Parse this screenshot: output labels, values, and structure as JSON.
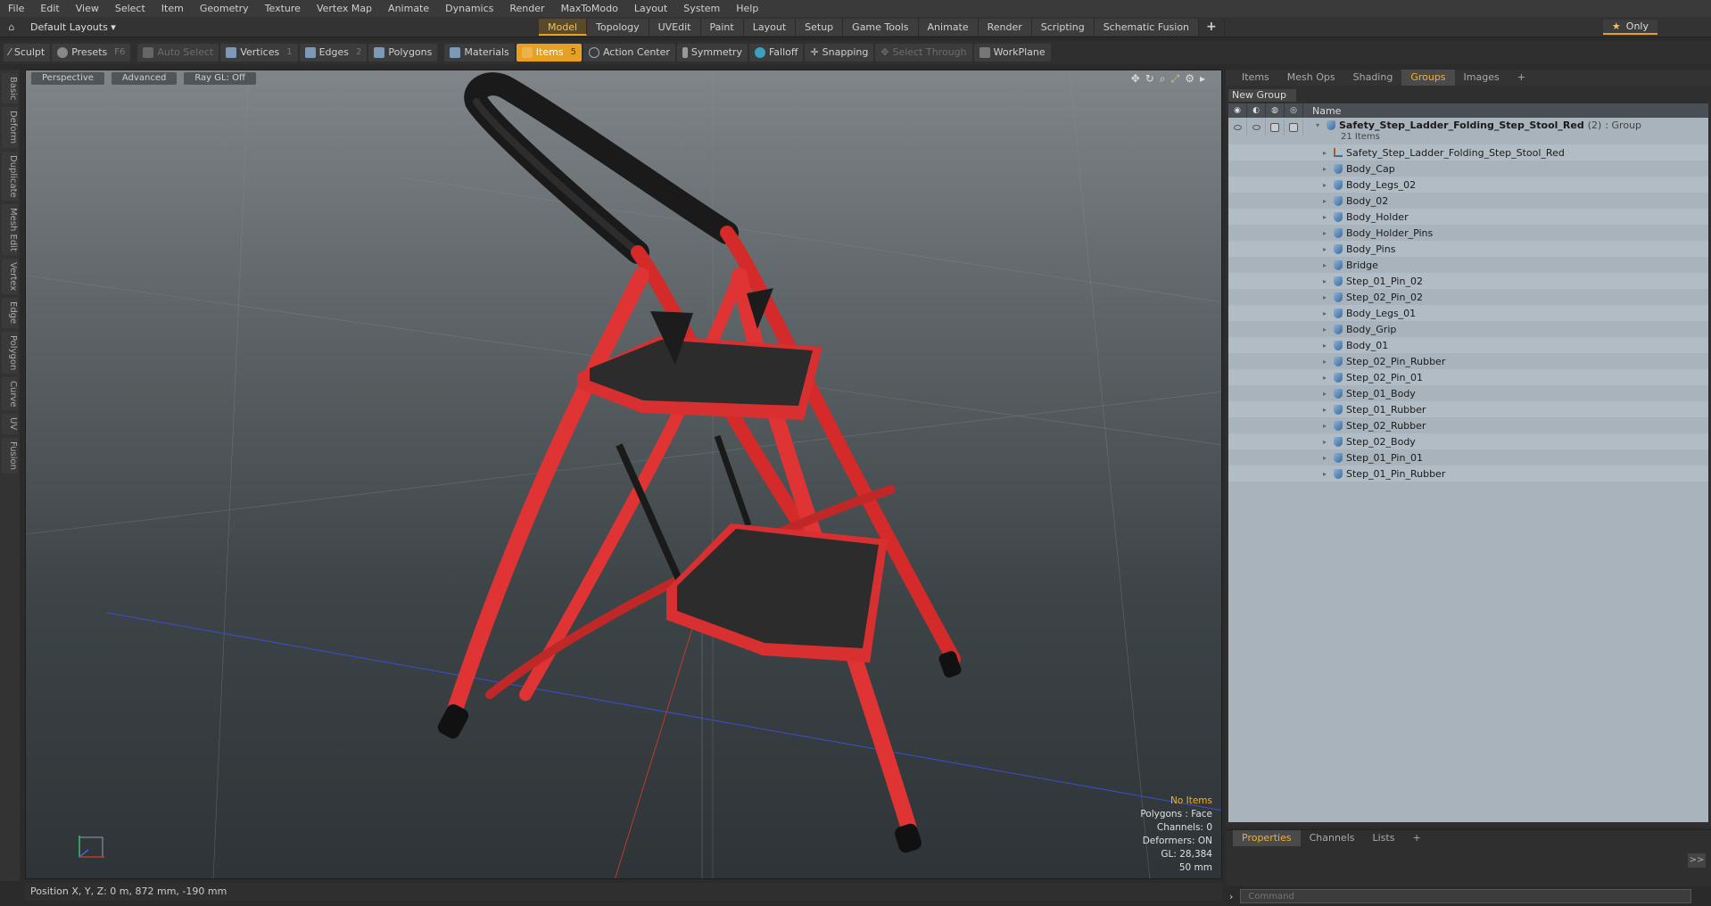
{
  "menubar": {
    "items": [
      "File",
      "Edit",
      "View",
      "Select",
      "Item",
      "Geometry",
      "Texture",
      "Vertex Map",
      "Animate",
      "Dynamics",
      "Render",
      "MaxToModo",
      "Layout",
      "System",
      "Help"
    ]
  },
  "layoutrow": {
    "layouts_label": "Default Layouts ▾",
    "tabs": [
      "Model",
      "Topology",
      "UVEdit",
      "Paint",
      "Layout",
      "Setup",
      "Game Tools",
      "Animate",
      "Render",
      "Scripting",
      "Schematic Fusion"
    ],
    "active_tab": "Model",
    "plus": "+",
    "only_label": "Only"
  },
  "toolbar": {
    "sculpt": "Sculpt",
    "presets": "Presets",
    "presets_key": "F6",
    "auto_select": "Auto Select",
    "vertices": "Vertices",
    "vertices_count": "1",
    "edges": "Edges",
    "edges_count": "2",
    "polygons": "Polygons",
    "materials": "Materials",
    "items": "Items",
    "items_count": "5",
    "action_center": "Action Center",
    "symmetry": "Symmetry",
    "falloff": "Falloff",
    "snapping": "Snapping",
    "select_through": "Select Through",
    "workplane": "WorkPlane"
  },
  "leftstrip": {
    "tabs": [
      "Basic",
      "Deform",
      "Duplicate",
      "Mesh Edit",
      "Vertex",
      "Edge",
      "Polygon",
      "Curve",
      "UV",
      "Fusion"
    ]
  },
  "viewport": {
    "view_label": "Perspective",
    "advanced_label": "Advanced",
    "raygl_label": "Ray GL: Off",
    "stats": {
      "no_items": "No Items",
      "polygons": "Polygons : Face",
      "channels": "Channels: 0",
      "deformers": "Deformers: ON",
      "gl": "GL: 28,384",
      "size": "50 mm"
    }
  },
  "statusbar": {
    "position": "Position X, Y, Z:  0 m, 872 mm, -190 mm"
  },
  "rightpanel": {
    "tabs": [
      "Items",
      "Mesh Ops",
      "Shading",
      "Groups",
      "Images",
      "+"
    ],
    "active_tab": "Groups",
    "new_group": "New Group",
    "name_header": "Name",
    "group": {
      "name": "Safety_Step_Ladder_Folding_Step_Stool_Red",
      "count": "(2)",
      "type": ": Group",
      "sub": "21 Items"
    },
    "items": [
      "Safety_Step_Ladder_Folding_Step_Stool_Red",
      "Body_Cap",
      "Body_Legs_02",
      "Body_02",
      "Body_Holder",
      "Body_Holder_Pins",
      "Body_Pins",
      "Bridge",
      "Step_01_Pin_02",
      "Step_02_Pin_02",
      "Body_Legs_01",
      "Body_Grip",
      "Body_01",
      "Step_02_Pin_Rubber",
      "Step_02_Pin_01",
      "Step_01_Body",
      "Step_01_Rubber",
      "Step_02_Rubber",
      "Step_02_Body",
      "Step_01_Pin_01",
      "Step_01_Pin_Rubber"
    ]
  },
  "propspanel": {
    "tabs": [
      "Properties",
      "Channels",
      "Lists",
      "+"
    ],
    "active_tab": "Properties",
    "command_placeholder": "Command",
    "expand": ">>"
  }
}
